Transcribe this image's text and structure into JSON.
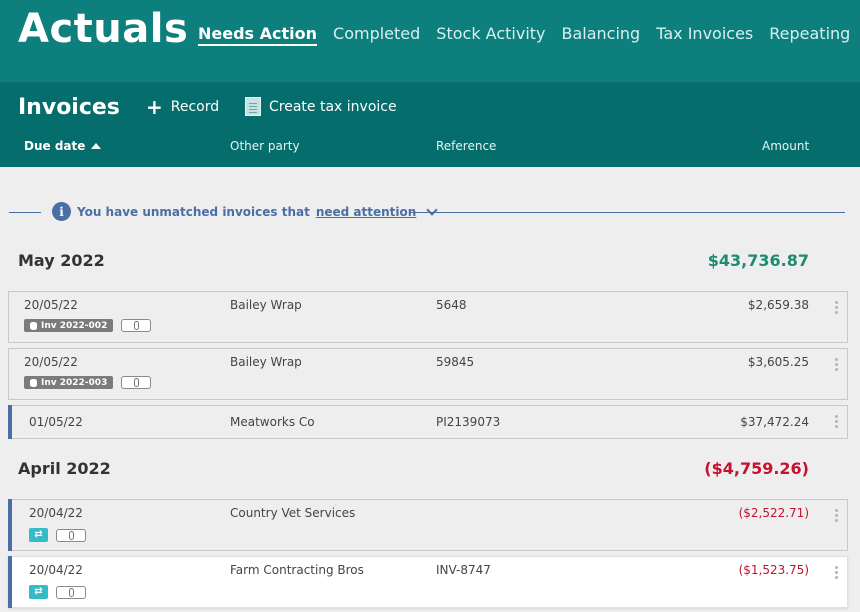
{
  "app": {
    "title": "Actuals"
  },
  "nav": {
    "tabs": [
      {
        "label": "Needs Action",
        "active": true
      },
      {
        "label": "Completed",
        "active": false
      },
      {
        "label": "Stock Activity",
        "active": false
      },
      {
        "label": "Balancing",
        "active": false
      },
      {
        "label": "Tax Invoices",
        "active": false
      },
      {
        "label": "Repeating",
        "active": false
      }
    ]
  },
  "section": {
    "title": "Invoices",
    "record_label": "Record",
    "create_label": "Create tax invoice"
  },
  "columns": {
    "due_date": "Due date",
    "other_party": "Other party",
    "reference": "Reference",
    "amount": "Amount"
  },
  "notice": {
    "text": "You have unmatched invoices that",
    "link": "need attention"
  },
  "groups": [
    {
      "month": "May 2022",
      "total": "$43,736.87",
      "rows": [
        {
          "date": "20/05/22",
          "party": "Bailey Wrap",
          "reference": "5648",
          "amount": "$2,659.38",
          "tag": "Inv 2022-002"
        },
        {
          "date": "20/05/22",
          "party": "Bailey Wrap",
          "reference": "59845",
          "amount": "$3,605.25",
          "tag": "Inv 2022-003"
        },
        {
          "date": "01/05/22",
          "party": "Meatworks Co",
          "reference": "PI2139073",
          "amount": "$37,472.24"
        }
      ]
    },
    {
      "month": "April 2022",
      "total": "($4,759.26)",
      "rows": [
        {
          "date": "20/04/22",
          "party": "Country Vet Services",
          "reference": "",
          "amount": "($2,522.71)"
        },
        {
          "date": "20/04/22",
          "party": "Farm Contracting Bros",
          "reference": "INV-8747",
          "amount": "($1,523.75)"
        }
      ]
    }
  ],
  "icons": {
    "sync_glyph": "⇄"
  },
  "colors": {
    "header": "#0d7f7d",
    "subheader": "#056e6c",
    "positive": "#1f8a70",
    "negative": "#c4122f",
    "accent": "#4a6fa5",
    "sync_tag": "#33bcc7"
  }
}
